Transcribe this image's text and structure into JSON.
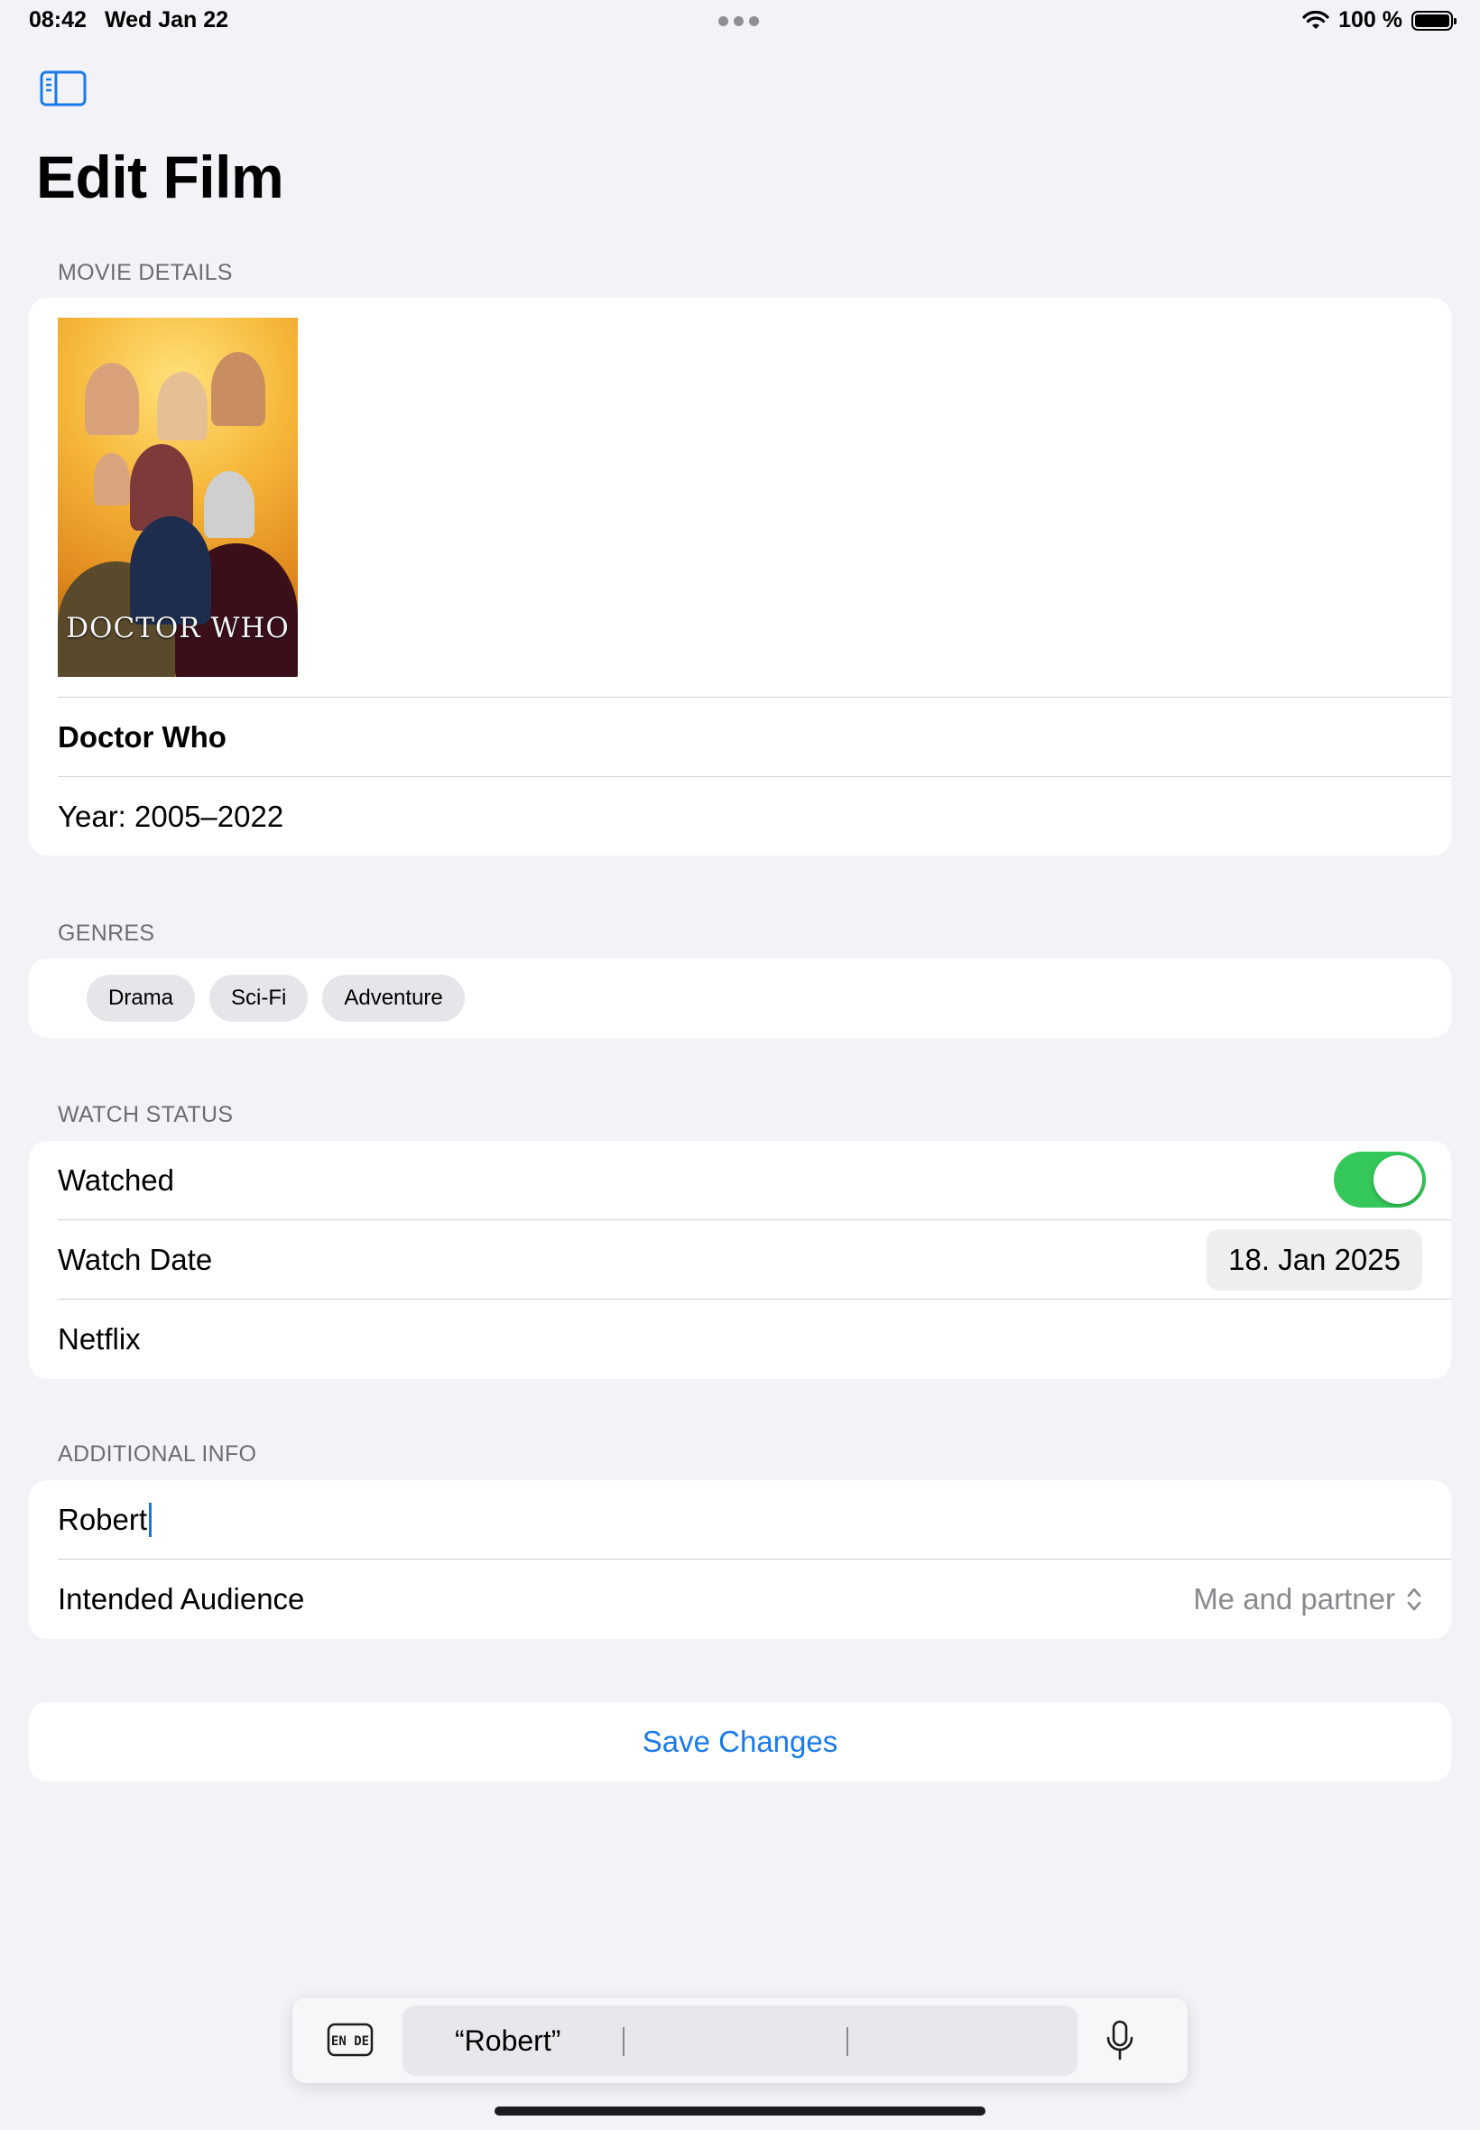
{
  "status_bar": {
    "time": "08:42",
    "date": "Wed Jan 22",
    "battery": "100 %"
  },
  "page": {
    "title": "Edit Film"
  },
  "movie_details": {
    "header": "MOVIE DETAILS",
    "poster_logo": "DOCTOR WHO",
    "title": "Doctor Who",
    "year": "Year: 2005–2022"
  },
  "genres": {
    "header": "GENRES",
    "items": [
      "Drama",
      "Sci-Fi",
      "Adventure"
    ]
  },
  "watch_status": {
    "header": "WATCH STATUS",
    "watched_label": "Watched",
    "watched_on": true,
    "watch_date_label": "Watch Date",
    "watch_date_value": "18. Jan 2025",
    "platform": "Netflix"
  },
  "additional_info": {
    "header": "ADDITIONAL INFO",
    "note_value": "Robert",
    "audience_label": "Intended Audience",
    "audience_value": "Me and partner"
  },
  "actions": {
    "save_label": "Save Changes"
  },
  "keyboard": {
    "suggestion": "“Robert”"
  },
  "colors": {
    "accent": "#1a7ae8",
    "toggle_on": "#34c759",
    "background": "#f2f2f7"
  }
}
